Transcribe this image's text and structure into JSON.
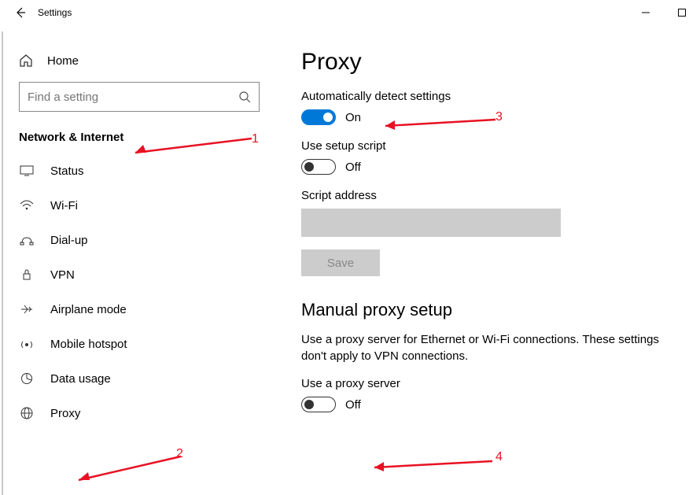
{
  "titlebar": {
    "title": "Settings"
  },
  "sidebar": {
    "home": "Home",
    "search_placeholder": "Find a setting",
    "category": "Network & Internet",
    "items": [
      {
        "label": "Status"
      },
      {
        "label": "Wi-Fi"
      },
      {
        "label": "Dial-up"
      },
      {
        "label": "VPN"
      },
      {
        "label": "Airplane mode"
      },
      {
        "label": "Mobile hotspot"
      },
      {
        "label": "Data usage"
      },
      {
        "label": "Proxy"
      }
    ]
  },
  "page": {
    "title": "Proxy",
    "auto_detect_label": "Automatically detect settings",
    "auto_detect_state": "On",
    "setup_script_label": "Use setup script",
    "setup_script_state": "Off",
    "script_address_label": "Script address",
    "save_label": "Save",
    "manual_header": "Manual proxy setup",
    "manual_desc": "Use a proxy server for Ethernet or Wi-Fi connections. These settings don't apply to VPN connections.",
    "use_proxy_label": "Use a proxy server",
    "use_proxy_state": "Off"
  },
  "annotations": {
    "n1": "1",
    "n2": "2",
    "n3": "3",
    "n4": "4"
  }
}
